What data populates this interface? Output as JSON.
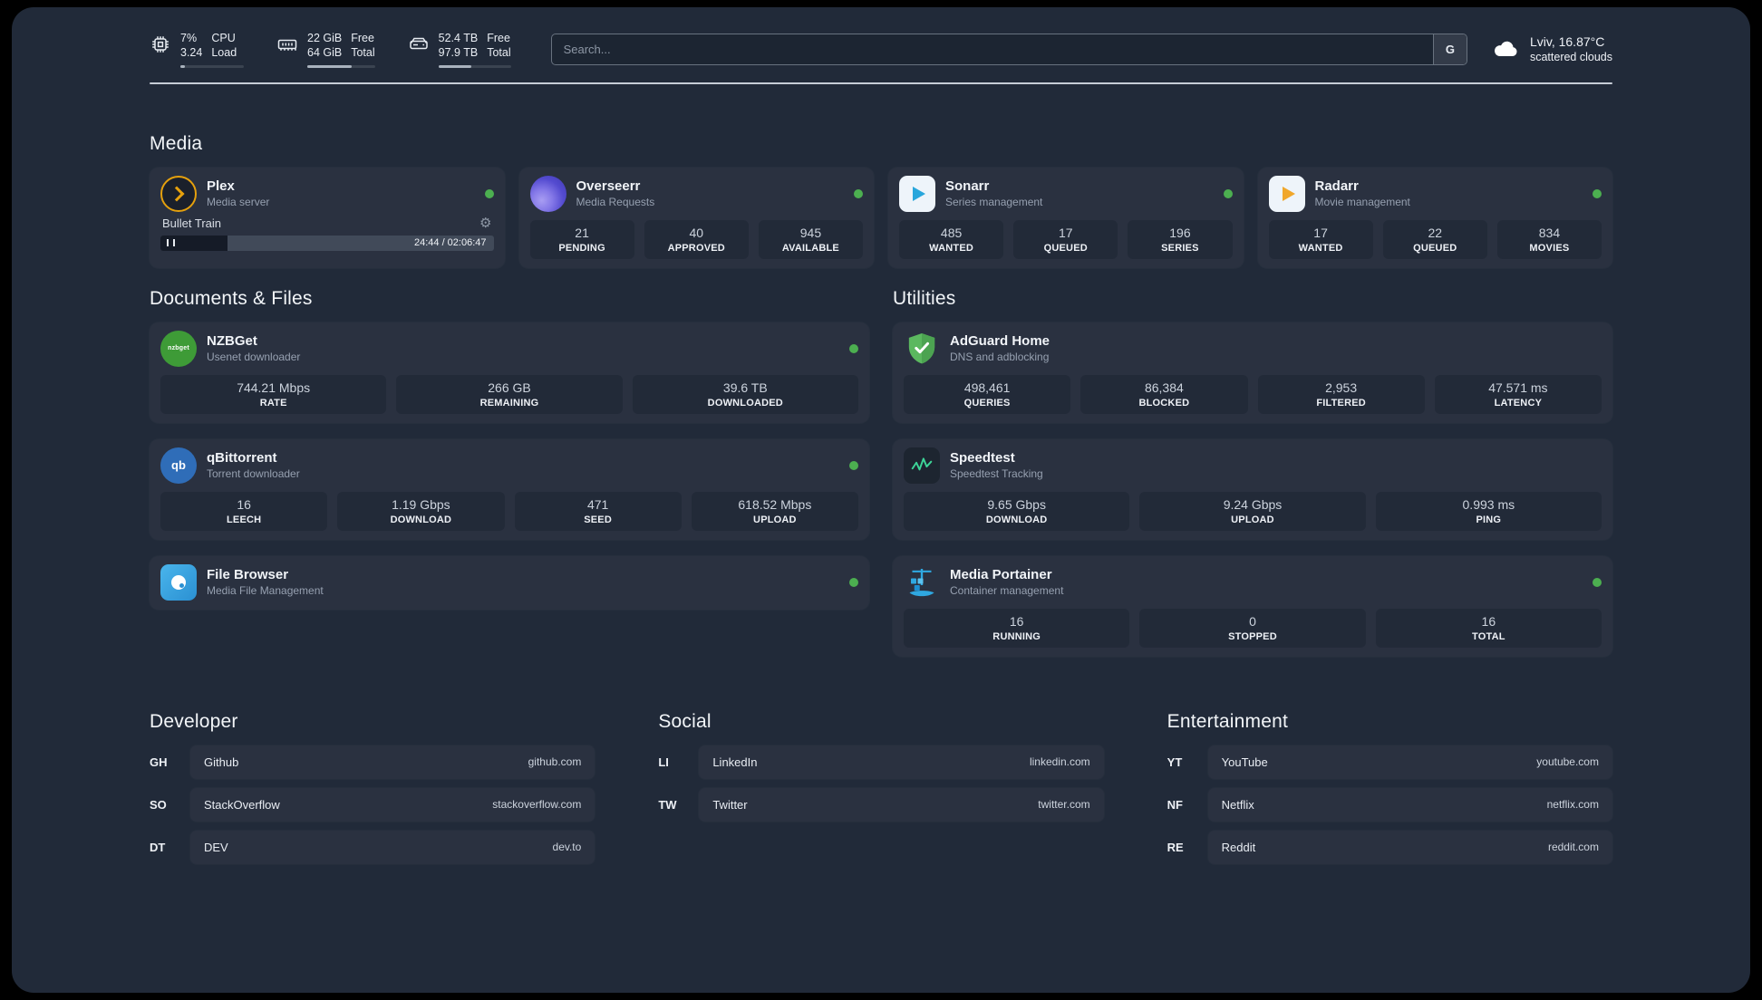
{
  "header": {
    "cpu": {
      "values": [
        "7%",
        "3.24"
      ],
      "labels": [
        "CPU",
        "Load"
      ],
      "bar_percent": 7
    },
    "memory": {
      "values": [
        "22 GiB",
        "64 GiB"
      ],
      "labels": [
        "Free",
        "Total"
      ],
      "bar_percent": 66
    },
    "storage": {
      "values": [
        "52.4 TB",
        "97.9 TB"
      ],
      "labels": [
        "Free",
        "Total"
      ],
      "bar_percent": 46
    },
    "search": {
      "placeholder": "Search...",
      "engine_label": "G"
    },
    "weather": {
      "location": "Lviv, 16.87°C",
      "condition": "scattered clouds"
    }
  },
  "media": {
    "title": "Media",
    "plex": {
      "title": "Plex",
      "subtitle": "Media server",
      "player": {
        "track": "Bullet Train",
        "time": "24:44 / 02:06:47",
        "progress_percent": 20
      }
    },
    "overseerr": {
      "title": "Overseerr",
      "subtitle": "Media Requests",
      "stats": [
        {
          "value": "21",
          "label": "PENDING"
        },
        {
          "value": "40",
          "label": "APPROVED"
        },
        {
          "value": "945",
          "label": "AVAILABLE"
        }
      ]
    },
    "sonarr": {
      "title": "Sonarr",
      "subtitle": "Series management",
      "stats": [
        {
          "value": "485",
          "label": "WANTED"
        },
        {
          "value": "17",
          "label": "QUEUED"
        },
        {
          "value": "196",
          "label": "SERIES"
        }
      ]
    },
    "radarr": {
      "title": "Radarr",
      "subtitle": "Movie management",
      "stats": [
        {
          "value": "17",
          "label": "WANTED"
        },
        {
          "value": "22",
          "label": "QUEUED"
        },
        {
          "value": "834",
          "label": "MOVIES"
        }
      ]
    }
  },
  "documents": {
    "title": "Documents & Files",
    "nzbget": {
      "title": "NZBGet",
      "subtitle": "Usenet downloader",
      "stats": [
        {
          "value": "744.21 Mbps",
          "label": "RATE"
        },
        {
          "value": "266 GB",
          "label": "REMAINING"
        },
        {
          "value": "39.6 TB",
          "label": "DOWNLOADED"
        }
      ]
    },
    "qbittorrent": {
      "title": "qBittorrent",
      "subtitle": "Torrent downloader",
      "stats": [
        {
          "value": "16",
          "label": "LEECH"
        },
        {
          "value": "1.19 Gbps",
          "label": "DOWNLOAD"
        },
        {
          "value": "471",
          "label": "SEED"
        },
        {
          "value": "618.52 Mbps",
          "label": "UPLOAD"
        }
      ]
    },
    "filebrowser": {
      "title": "File Browser",
      "subtitle": "Media File Management"
    }
  },
  "utilities": {
    "title": "Utilities",
    "adguard": {
      "title": "AdGuard Home",
      "subtitle": "DNS and adblocking",
      "stats": [
        {
          "value": "498,461",
          "label": "QUERIES"
        },
        {
          "value": "86,384",
          "label": "BLOCKED"
        },
        {
          "value": "2,953",
          "label": "FILTERED"
        },
        {
          "value": "47.571 ms",
          "label": "LATENCY"
        }
      ]
    },
    "speedtest": {
      "title": "Speedtest",
      "subtitle": "Speedtest Tracking",
      "stats": [
        {
          "value": "9.65 Gbps",
          "label": "DOWNLOAD"
        },
        {
          "value": "9.24 Gbps",
          "label": "UPLOAD"
        },
        {
          "value": "0.993 ms",
          "label": "PING"
        }
      ]
    },
    "portainer": {
      "title": "Media Portainer",
      "subtitle": "Container management",
      "stats": [
        {
          "value": "16",
          "label": "RUNNING"
        },
        {
          "value": "0",
          "label": "STOPPED"
        },
        {
          "value": "16",
          "label": "TOTAL"
        }
      ]
    }
  },
  "developer": {
    "title": "Developer",
    "links": [
      {
        "abbr": "GH",
        "name": "Github",
        "url": "github.com"
      },
      {
        "abbr": "SO",
        "name": "StackOverflow",
        "url": "stackoverflow.com"
      },
      {
        "abbr": "DT",
        "name": "DEV",
        "url": "dev.to"
      }
    ]
  },
  "social": {
    "title": "Social",
    "links": [
      {
        "abbr": "LI",
        "name": "LinkedIn",
        "url": "linkedin.com"
      },
      {
        "abbr": "TW",
        "name": "Twitter",
        "url": "twitter.com"
      }
    ]
  },
  "entertainment": {
    "title": "Entertainment",
    "links": [
      {
        "abbr": "YT",
        "name": "YouTube",
        "url": "youtube.com"
      },
      {
        "abbr": "NF",
        "name": "Netflix",
        "url": "netflix.com"
      },
      {
        "abbr": "RE",
        "name": "Reddit",
        "url": "reddit.com"
      }
    ]
  },
  "icons": {
    "gear": "⚙",
    "nzbget_text": "nzbget",
    "qbittorrent_text": "qb"
  },
  "colors": {
    "status_online": "#4caf50"
  }
}
